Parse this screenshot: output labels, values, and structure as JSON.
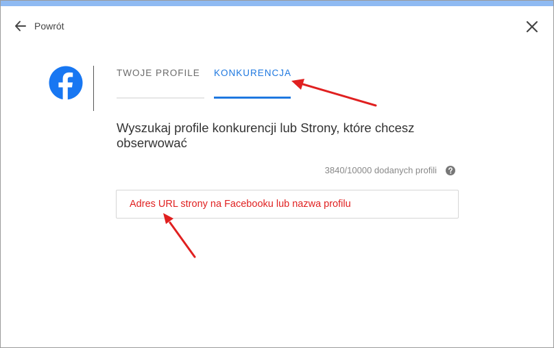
{
  "colors": {
    "top_bar": "#8fbaf2",
    "facebook_brand": "#1877f2",
    "active_tab": "#1e78e0",
    "annotation_red": "#e02020"
  },
  "header": {
    "back_label": "Powrót",
    "back_icon": "arrow-left-icon",
    "close_icon": "close-icon"
  },
  "tabs": [
    {
      "label": "TWOJE PROFILE",
      "active": false
    },
    {
      "label": "KONKURENCJA",
      "active": true
    }
  ],
  "main": {
    "heading": "Wyszukaj profile konkurencji lub Strony, które chcesz obserwować",
    "counter": "3840/10000 dodanych profili",
    "help_icon": "question-circle-icon",
    "search": {
      "value": "",
      "placeholder": "Adres URL strony na Facebooku lub nazwa profilu"
    }
  },
  "annotations": [
    "red-arrow-to-tab",
    "red-arrow-to-input"
  ]
}
